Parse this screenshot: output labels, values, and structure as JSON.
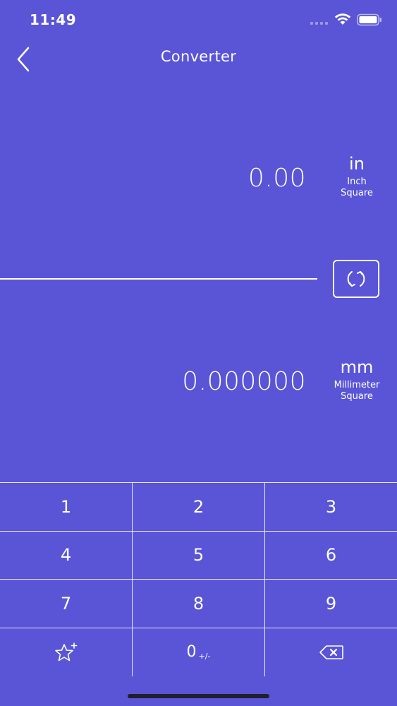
{
  "status_bar": {
    "time": "11:49"
  },
  "nav": {
    "title": "Converter"
  },
  "converter": {
    "from": {
      "value": "0.00",
      "unit_symbol": "in",
      "unit_name_line1": "Inch",
      "unit_name_line2": "Square"
    },
    "to": {
      "value": "0.000000",
      "unit_symbol": "mm",
      "unit_name_line1": "Millimeter",
      "unit_name_line2": "Square"
    }
  },
  "keypad": {
    "rows": [
      [
        "1",
        "2",
        "3"
      ],
      [
        "4",
        "5",
        "6"
      ],
      [
        "7",
        "8",
        "9"
      ]
    ],
    "zero_label": "0",
    "sign_label": "+/-"
  },
  "icons": {
    "back": "chevron-left-icon",
    "swap": "swap-arrows-icon",
    "favorite": "star-plus-icon",
    "backspace": "backspace-icon"
  },
  "colors": {
    "background": "#5a55d6",
    "foreground": "#ffffff"
  }
}
